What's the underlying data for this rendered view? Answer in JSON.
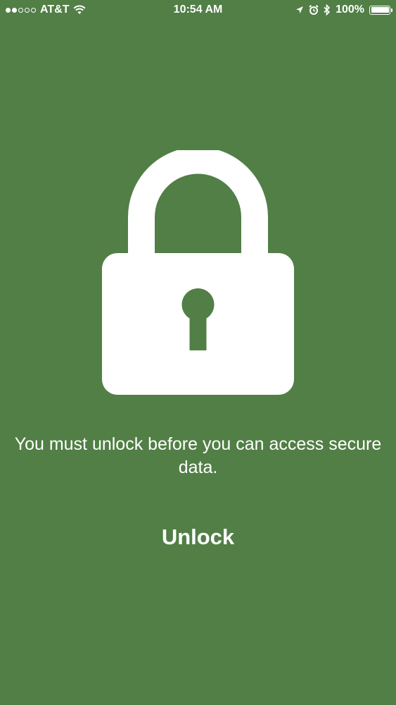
{
  "status_bar": {
    "carrier": "AT&T",
    "time": "10:54 AM",
    "battery_percent": "100%",
    "signal_strength": 2,
    "signal_max": 5,
    "icons": [
      "wifi-icon",
      "location-arrow-icon",
      "alarm-icon",
      "bluetooth-icon",
      "battery-icon"
    ]
  },
  "lock_screen": {
    "icon": "padlock-icon",
    "message": "You must unlock before you can access secure data.",
    "unlock_label": "Unlock"
  },
  "colors": {
    "background": "#517f46",
    "foreground": "#ffffff"
  }
}
